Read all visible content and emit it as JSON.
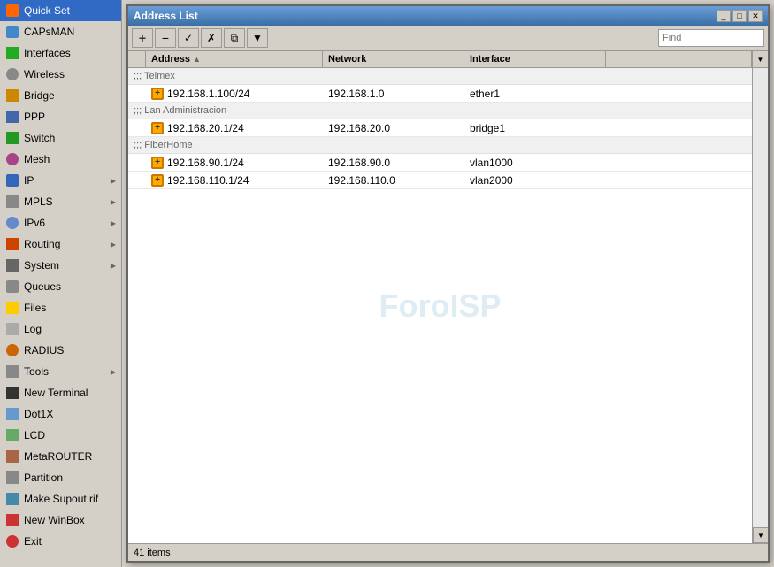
{
  "sidebar": {
    "items": [
      {
        "id": "quick-set",
        "label": "Quick Set",
        "icon": "quickset",
        "arrow": false
      },
      {
        "id": "capsman",
        "label": "CAPsMAN",
        "icon": "capsman",
        "arrow": false
      },
      {
        "id": "interfaces",
        "label": "Interfaces",
        "icon": "interfaces",
        "arrow": false
      },
      {
        "id": "wireless",
        "label": "Wireless",
        "icon": "wireless",
        "arrow": false
      },
      {
        "id": "bridge",
        "label": "Bridge",
        "icon": "bridge",
        "arrow": false
      },
      {
        "id": "ppp",
        "label": "PPP",
        "icon": "ppp",
        "arrow": false
      },
      {
        "id": "switch",
        "label": "Switch",
        "icon": "switch",
        "arrow": false
      },
      {
        "id": "mesh",
        "label": "Mesh",
        "icon": "mesh",
        "arrow": false
      },
      {
        "id": "ip",
        "label": "IP",
        "icon": "ip",
        "arrow": true
      },
      {
        "id": "mpls",
        "label": "MPLS",
        "icon": "mpls",
        "arrow": true
      },
      {
        "id": "ipv6",
        "label": "IPv6",
        "icon": "ipv6",
        "arrow": true
      },
      {
        "id": "routing",
        "label": "Routing",
        "icon": "routing",
        "arrow": true
      },
      {
        "id": "system",
        "label": "System",
        "icon": "system",
        "arrow": true
      },
      {
        "id": "queues",
        "label": "Queues",
        "icon": "queues",
        "arrow": false
      },
      {
        "id": "files",
        "label": "Files",
        "icon": "files",
        "arrow": false
      },
      {
        "id": "log",
        "label": "Log",
        "icon": "log",
        "arrow": false
      },
      {
        "id": "radius",
        "label": "RADIUS",
        "icon": "radius",
        "arrow": false
      },
      {
        "id": "tools",
        "label": "Tools",
        "icon": "tools",
        "arrow": true
      },
      {
        "id": "new-terminal",
        "label": "New Terminal",
        "icon": "newterminal",
        "arrow": false
      },
      {
        "id": "dot1x",
        "label": "Dot1X",
        "icon": "dot1x",
        "arrow": false
      },
      {
        "id": "lcd",
        "label": "LCD",
        "icon": "lcd",
        "arrow": false
      },
      {
        "id": "metarouter",
        "label": "MetaROUTER",
        "icon": "metarouter",
        "arrow": false
      },
      {
        "id": "partition",
        "label": "Partition",
        "icon": "partition",
        "arrow": false
      },
      {
        "id": "supout",
        "label": "Make Supout.rif",
        "icon": "supout",
        "arrow": false
      },
      {
        "id": "winbox",
        "label": "New WinBox",
        "icon": "winbox",
        "arrow": false
      },
      {
        "id": "exit",
        "label": "Exit",
        "icon": "exit",
        "arrow": false
      }
    ]
  },
  "window": {
    "title": "Address List",
    "toolbar": {
      "add_label": "+",
      "remove_label": "−",
      "enable_label": "✓",
      "disable_label": "✗",
      "copy_label": "⧉",
      "filter_label": "▼",
      "find_placeholder": "Find"
    },
    "table": {
      "columns": [
        {
          "id": "address",
          "label": "Address",
          "sortable": true
        },
        {
          "id": "network",
          "label": "Network",
          "sortable": false
        },
        {
          "id": "interface",
          "label": "Interface",
          "sortable": false
        }
      ],
      "groups": [
        {
          "comment": ";;; Telmex",
          "rows": [
            {
              "address": "192.168.1.100/24",
              "network": "192.168.1.0",
              "interface": "ether1"
            }
          ]
        },
        {
          "comment": ";;; Lan Administracion",
          "rows": [
            {
              "address": "192.168.20.1/24",
              "network": "192.168.20.0",
              "interface": "bridge1"
            }
          ]
        },
        {
          "comment": ";;; FiberHome",
          "rows": [
            {
              "address": "192.168.90.1/24",
              "network": "192.168.90.0",
              "interface": "vlan1000"
            },
            {
              "address": "192.168.110.1/24",
              "network": "192.168.110.0",
              "interface": "vlan2000"
            }
          ]
        }
      ]
    },
    "status": "41 items",
    "watermark": "ForoISP"
  }
}
